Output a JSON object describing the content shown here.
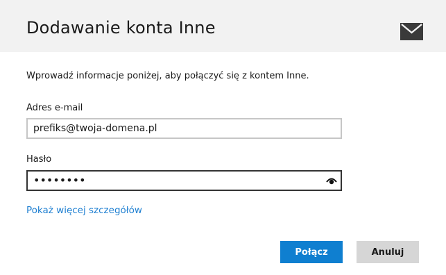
{
  "dialog": {
    "title": "Dodawanie konta Inne",
    "header_icon": "mail-icon"
  },
  "form": {
    "intro": "Wprowadź informacje poniżej, aby połączyć się z kontem Inne.",
    "email": {
      "label": "Adres e-mail",
      "value": "prefiks@twoja-domena.pl"
    },
    "password": {
      "label": "Hasło",
      "value": "••••••••",
      "reveal_icon": "eye-icon"
    },
    "more_details_link": "Pokaż więcej szczegółów"
  },
  "buttons": {
    "connect": "Połącz",
    "cancel": "Anuluj"
  },
  "colors": {
    "header_bg": "#f2f2f2",
    "accent": "#0f7fd0",
    "link": "#1e7fd1",
    "cancel_bg": "#d6d6d6"
  }
}
